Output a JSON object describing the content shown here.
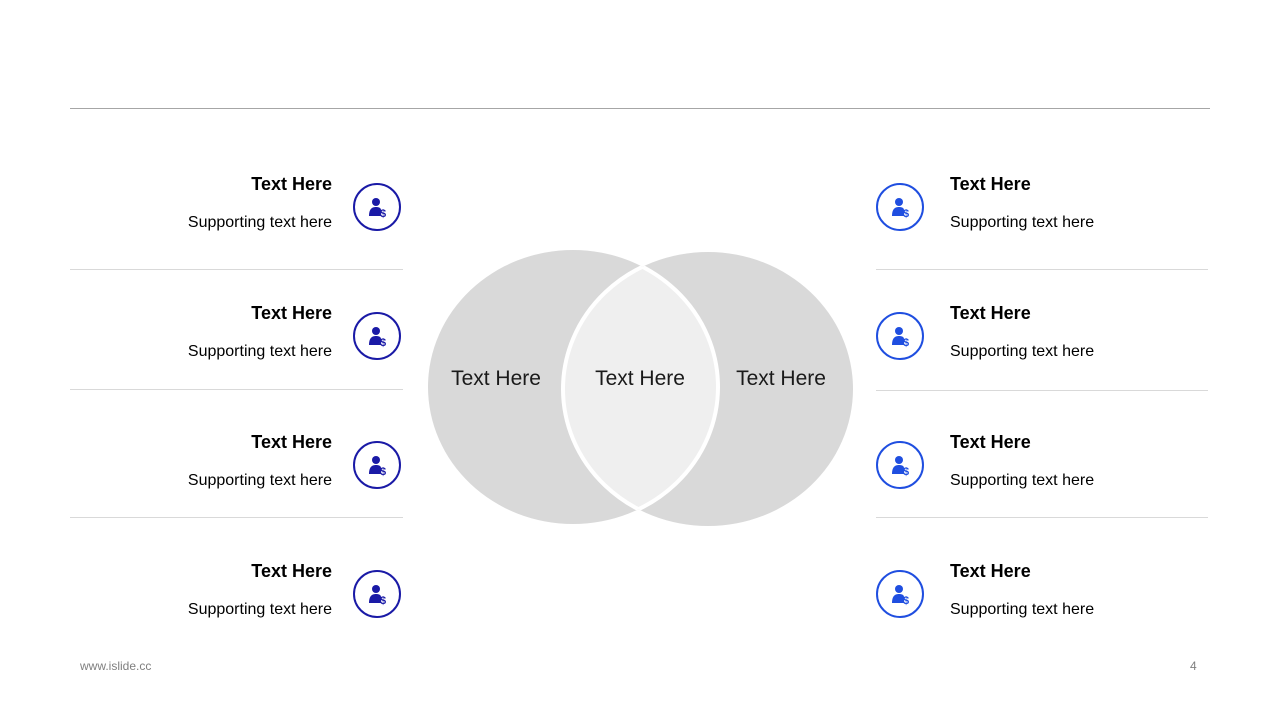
{
  "left_items": [
    {
      "title": "Text Here",
      "subtitle": "Supporting text here",
      "icon": "user-dollar-icon"
    },
    {
      "title": "Text Here",
      "subtitle": "Supporting text here",
      "icon": "user-dollar-icon"
    },
    {
      "title": "Text Here",
      "subtitle": "Supporting text here",
      "icon": "user-dollar-icon"
    },
    {
      "title": "Text Here",
      "subtitle": "Supporting text here",
      "icon": "user-dollar-icon"
    }
  ],
  "right_items": [
    {
      "title": "Text Here",
      "subtitle": "Supporting text here",
      "icon": "user-dollar-icon"
    },
    {
      "title": "Text Here",
      "subtitle": "Supporting text here",
      "icon": "user-dollar-icon"
    },
    {
      "title": "Text Here",
      "subtitle": "Supporting text here",
      "icon": "user-dollar-icon"
    },
    {
      "title": "Text Here",
      "subtitle": "Supporting text here",
      "icon": "user-dollar-icon"
    }
  ],
  "venn": {
    "left_label": "Text Here",
    "center_label": "Text Here",
    "right_label": "Text Here"
  },
  "colors": {
    "left_icon": "#1a1aa6",
    "right_icon": "#1f4ee0",
    "circle_fill": "#d9d9d9",
    "overlap_fill": "#efefef"
  },
  "footer": {
    "url": "www.islide.cc",
    "page_number": "4"
  }
}
